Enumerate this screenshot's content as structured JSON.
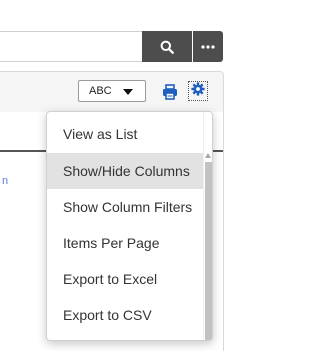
{
  "search": {
    "value": "",
    "placeholder": ""
  },
  "toolbar": {
    "view_select": "ABC"
  },
  "grid": {
    "link_fragment": "n"
  },
  "menu": {
    "items": [
      {
        "label": "View as List",
        "active": false
      },
      {
        "label": "Show/Hide Columns",
        "active": true
      },
      {
        "label": "Show Column Filters",
        "active": false
      },
      {
        "label": "Items Per Page",
        "active": false
      },
      {
        "label": "Export to Excel",
        "active": false
      },
      {
        "label": "Export to CSV",
        "active": false
      }
    ]
  },
  "colors": {
    "dark_button": "#4d4d4d",
    "icon_blue": "#1f5fbf",
    "menu_highlight": "#e2e2e2",
    "link": "#5a7fd6"
  },
  "icons": {
    "search": "magnifier",
    "more": "ellipsis-horizontal",
    "print": "printer",
    "settings": "gear"
  }
}
